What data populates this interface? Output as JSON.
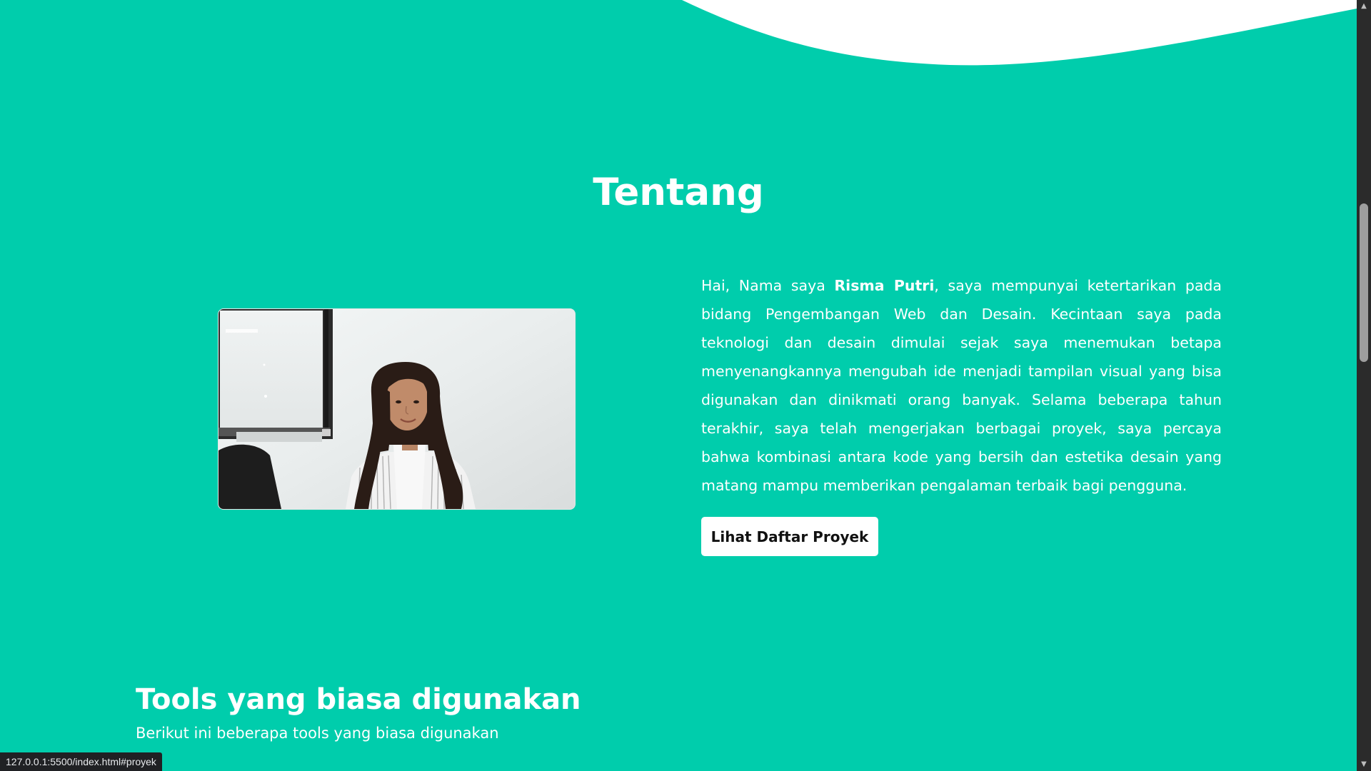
{
  "about": {
    "title": "Tentang",
    "intro_prefix": "Hai, Nama saya ",
    "name": "Risma Putri",
    "intro_rest": ", saya mempunyai ketertarikan pada bidang Pengembangan Web dan Desain. Kecintaan saya pada teknologi dan desain dimulai sejak saya menemukan betapa menyenangkannya mengubah ide menjadi tampilan visual yang bisa digunakan dan dinikmati orang banyak. Selama beberapa tahun terakhir, saya telah mengerjakan berbagai proyek, saya percaya bahwa kombinasi antara kode yang bersih dan estetika desain yang matang mampu memberikan pengalaman terbaik bagi pengguna.",
    "cta_label": "Lihat Daftar Proyek",
    "photo_icon": "profile-photo"
  },
  "tools": {
    "title": "Tools yang biasa digunakan",
    "subtitle": "Berikut ini beberapa tools yang biasa digunakan"
  },
  "browser": {
    "status_url": "127.0.0.1:5500/index.html#proyek"
  },
  "colors": {
    "background": "#00CDAC",
    "text": "#FFFFFF",
    "button_bg": "#FFFFFF",
    "button_text": "#111111"
  }
}
